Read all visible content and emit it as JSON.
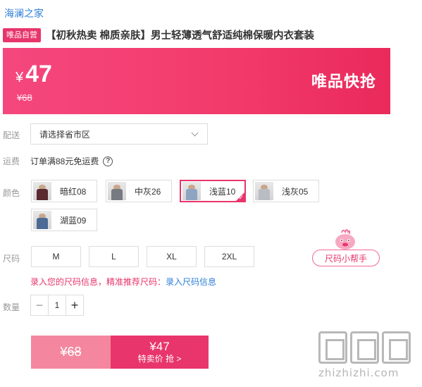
{
  "store": {
    "name": "海澜之家"
  },
  "product": {
    "badge": "唯品自营",
    "title": "【初秋热卖 棉质亲肤】男士轻薄透气舒适纯棉保暖内衣套装"
  },
  "price_banner": {
    "currency": "¥",
    "price": "47",
    "original_price": "¥68",
    "flash_label": "唯品快抢",
    "bg_color": "#f23a6a"
  },
  "delivery": {
    "label": "配送",
    "select_value": "请选择省市区"
  },
  "shipping": {
    "label": "运费",
    "text": "订单满88元免运费",
    "help_icon": "?"
  },
  "colors": {
    "label": "颜色",
    "options": [
      {
        "name": "暗红08",
        "selected": false,
        "shirt": "#5a2a30"
      },
      {
        "name": "中灰26",
        "selected": false,
        "shirt": "#777a80"
      },
      {
        "name": "浅蓝10",
        "selected": true,
        "shirt": "#8ea4c2"
      },
      {
        "name": "浅灰05",
        "selected": false,
        "shirt": "#b9bcc2"
      },
      {
        "name": "湖蓝09",
        "selected": false,
        "shirt": "#4b6b95"
      }
    ]
  },
  "sizes": {
    "label": "尺码",
    "options": [
      "M",
      "L",
      "XL",
      "2XL"
    ],
    "helper_label": "尺码小帮手",
    "tip_text": "录入您的尺码信息，精准推荐尺码：",
    "tip_link": "录入尺码信息"
  },
  "quantity": {
    "label": "数量",
    "value": "1",
    "minus": "−",
    "plus": "+"
  },
  "buy_bar": {
    "original_price": "¥68",
    "price": "¥47",
    "action_label": "特卖价 抢 >"
  },
  "watermark": {
    "text": "zhizhizhi.com"
  },
  "accent_color": "#e8356b",
  "link_color": "#2f7fd6"
}
